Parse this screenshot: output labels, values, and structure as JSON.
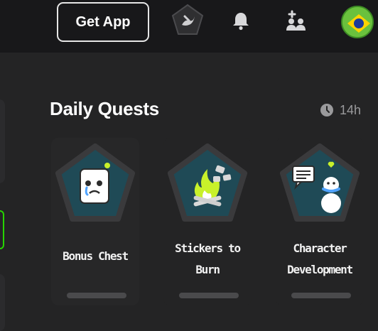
{
  "header": {
    "get_app_label": "Get App"
  },
  "daily_quests": {
    "title": "Daily Quests",
    "timer": "14h",
    "quests": [
      {
        "title": "Bonus Chest",
        "progress": 0
      },
      {
        "title_lines": [
          "Stickers to",
          "Burn"
        ],
        "progress": 0
      },
      {
        "title_lines": [
          "Character",
          "Development"
        ],
        "progress": 0
      }
    ]
  },
  "colors": {
    "badge_fill": "#1f4a56",
    "badge_border": "#3a3a3c",
    "accent_green": "#27d400"
  },
  "icons": [
    "logo-icon",
    "bell-icon",
    "friends-icon",
    "avatar",
    "clock-icon",
    "chest-icon",
    "stickers-fire-icon",
    "chat-snowman-icon"
  ]
}
